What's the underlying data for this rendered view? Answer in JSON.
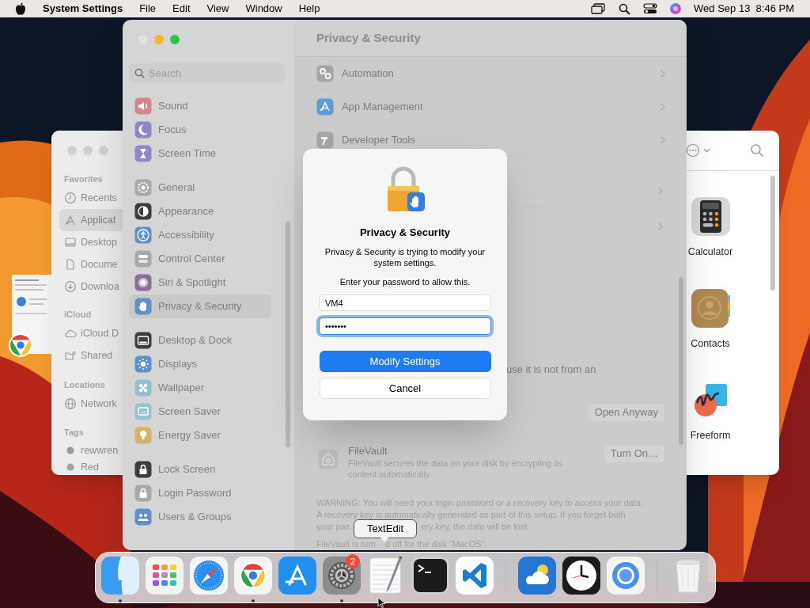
{
  "menu_bar": {
    "app_name": "System Settings",
    "menus": [
      "File",
      "Edit",
      "View",
      "Window",
      "Help"
    ],
    "clock": "Wed Sep 13  8:46 PM"
  },
  "finder_window": {
    "sidebar": [
      {
        "title": "Favorites",
        "items": [
          {
            "label": "Recents",
            "selected": false
          },
          {
            "label": "Applicat",
            "selected": true
          },
          {
            "label": "Desktop",
            "selected": false
          },
          {
            "label": "Docume",
            "selected": false
          },
          {
            "label": "Downloa",
            "selected": false
          }
        ]
      },
      {
        "title": "iCloud",
        "items": [
          {
            "label": "iCloud D",
            "selected": false
          },
          {
            "label": "Shared",
            "selected": false
          }
        ]
      },
      {
        "title": "Locations",
        "items": [
          {
            "label": "Network",
            "selected": false
          }
        ]
      },
      {
        "title": "Tags",
        "items": [
          {
            "label": "rewwren",
            "selected": false
          },
          {
            "label": "Red",
            "selected": false
          }
        ]
      }
    ],
    "apps": [
      {
        "name": "Calculator"
      },
      {
        "name": "Contacts"
      },
      {
        "name": "Freeform"
      }
    ]
  },
  "settings_window": {
    "title": "Privacy & Security",
    "search": {
      "placeholder": "Search"
    },
    "sidebar": [
      [
        {
          "label": "Sound",
          "selected": false
        },
        {
          "label": "Focus",
          "selected": false
        },
        {
          "label": "Screen Time",
          "selected": false
        }
      ],
      [
        {
          "label": "General",
          "selected": false
        },
        {
          "label": "Appearance",
          "selected": false
        },
        {
          "label": "Accessibility",
          "selected": false
        },
        {
          "label": "Control Center",
          "selected": false
        },
        {
          "label": "Siri & Spotlight",
          "selected": false
        },
        {
          "label": "Privacy & Security",
          "selected": true
        }
      ],
      [
        {
          "label": "Desktop & Dock",
          "selected": false
        },
        {
          "label": "Displays",
          "selected": false
        },
        {
          "label": "Wallpaper",
          "selected": false
        },
        {
          "label": "Screen Saver",
          "selected": false
        },
        {
          "label": "Energy Saver",
          "selected": false
        }
      ],
      [
        {
          "label": "Lock Screen",
          "selected": false
        },
        {
          "label": "Login Password",
          "selected": false
        },
        {
          "label": "Users & Groups",
          "selected": false
        }
      ]
    ],
    "rows": [
      {
        "label": "Automation"
      },
      {
        "label": "App Management"
      },
      {
        "label": "Developer Tools"
      }
    ],
    "security": {
      "text": "use it is not from an",
      "button": "Open Anyway"
    },
    "filevault": {
      "title": "FileVault",
      "description": "FileVault secures the data on your disk by encrypting its content automatically.",
      "button": "Turn On…"
    },
    "warning": [
      "WARNING: You will need your login password or a recovery key to access your data.",
      "A recovery key is automatically generated as part of this setup. If you forget both"
    ],
    "warning_fragments": [
      "your pas",
      "ery key, the data will be lost."
    ],
    "status_fragments": [
      "FileVault is turn",
      "d off for the disk \"MacOS\"."
    ]
  },
  "dialog": {
    "title": "Privacy & Security",
    "message": "Privacy & Security is trying to modify your system settings.",
    "prompt": "Enter your password to allow this.",
    "username": "VM4",
    "password": "•••••••",
    "buttons": [
      "Modify Settings",
      "Cancel"
    ]
  },
  "dock": {
    "apps": [
      {
        "running": true
      },
      {
        "running": false
      },
      {
        "running": false
      },
      {
        "running": true
      },
      {
        "running": false
      },
      {
        "running": true,
        "badge": "2"
      },
      {
        "running": false
      },
      {
        "running": false
      },
      {
        "running": false
      }
    ],
    "recent_apps": [
      {
        "running": false
      },
      {
        "running": false
      },
      {
        "running": false
      }
    ]
  },
  "tooltip": "TextEdit"
}
